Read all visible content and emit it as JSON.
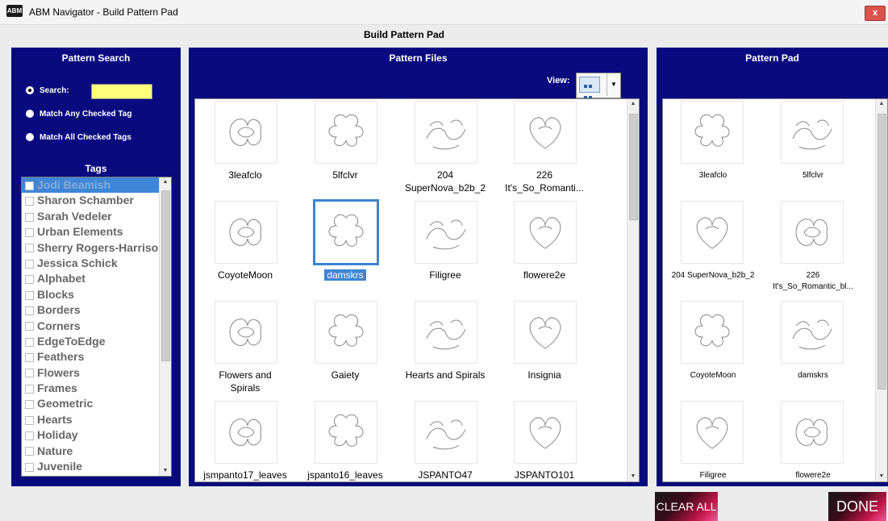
{
  "window": {
    "title": "ABM Navigator - Build Pattern Pad",
    "icon": "app-logo-icon",
    "close_label": "x"
  },
  "dialog_title": "Build Pattern Pad",
  "search_panel": {
    "title": "Pattern Search",
    "search_label": "Search:",
    "search_value": "",
    "match_any_label": "Match Any Checked Tag",
    "match_all_label": "Match All Checked Tags",
    "selected_option": "search"
  },
  "tags": {
    "label": "Tags",
    "items": [
      "Jodi Beamish",
      "Sharon Schamber",
      "Sarah Vedeler",
      "Urban Elements",
      "Sherry Rogers-Harrison",
      "Jessica Schick",
      "Alphabet",
      "Blocks",
      "Borders",
      "Corners",
      "EdgeToEdge",
      "Feathers",
      "Flowers",
      "Frames",
      "Geometric",
      "Hearts",
      "Holiday",
      "Nature",
      "Juvenile"
    ],
    "selected": "Jodi Beamish"
  },
  "files_panel": {
    "title": "Pattern Files",
    "view_label": "View:",
    "view_icon": "grid-view-icon",
    "patterns": [
      {
        "lines": [
          "3leafclo"
        ],
        "icon": "leaf-pattern"
      },
      {
        "lines": [
          "5lfclvr"
        ],
        "icon": "flower-outline"
      },
      {
        "lines": [
          "204",
          "SuperNova_b2b_2"
        ],
        "icon": "swirl-pattern"
      },
      {
        "lines": [
          "226",
          "It's_So_Romanti..."
        ],
        "icon": "heart-pattern"
      },
      {
        "lines": [
          "CoyoteMoon"
        ],
        "icon": "moon-pattern"
      },
      {
        "lines": [
          "damskrs"
        ],
        "icon": "damask-pattern"
      },
      {
        "lines": [
          "Filigree"
        ],
        "icon": "filigree-pattern"
      },
      {
        "lines": [
          "flowere2e"
        ],
        "icon": "flower-edge-pattern"
      },
      {
        "lines": [
          "Flowers and",
          "Spirals"
        ],
        "icon": "spiral-flower-pattern"
      },
      {
        "lines": [
          "Gaiety"
        ],
        "icon": "gaiety-pattern"
      },
      {
        "lines": [
          "Hearts and Spirals"
        ],
        "icon": "heart-spiral-pattern"
      },
      {
        "lines": [
          "Insignia"
        ],
        "icon": "insignia-pattern"
      },
      {
        "lines": [
          "jsmpanto17_leaves"
        ],
        "icon": "leaf-pattern"
      },
      {
        "lines": [
          "jspanto16_leaves"
        ],
        "icon": "leaves-pattern"
      },
      {
        "lines": [
          "JSPANTO47"
        ],
        "icon": "panto-pattern"
      },
      {
        "lines": [
          "JSPANTO101"
        ],
        "icon": "panto-leaf-pattern"
      }
    ],
    "selected": "damskrs"
  },
  "pad_panel": {
    "title": "Pattern Pad",
    "patterns": [
      {
        "lines": [
          "3leafclo"
        ]
      },
      {
        "lines": [
          "5lfclvr"
        ]
      },
      {
        "lines": [
          "204 SuperNova_b2b_2"
        ]
      },
      {
        "lines": [
          "226",
          "It's_So_Romantic_bl..."
        ]
      },
      {
        "lines": [
          "CoyoteMoon"
        ]
      },
      {
        "lines": [
          "damskrs"
        ]
      },
      {
        "lines": [
          "Filigree"
        ]
      },
      {
        "lines": [
          "flowere2e"
        ]
      }
    ]
  },
  "buttons": {
    "clear_all": "CLEAR ALL",
    "done": "DONE"
  },
  "colors": {
    "panel_bg": "#0a0a7f",
    "selection": "#3c85d3",
    "search_field": "#ffff7a"
  }
}
